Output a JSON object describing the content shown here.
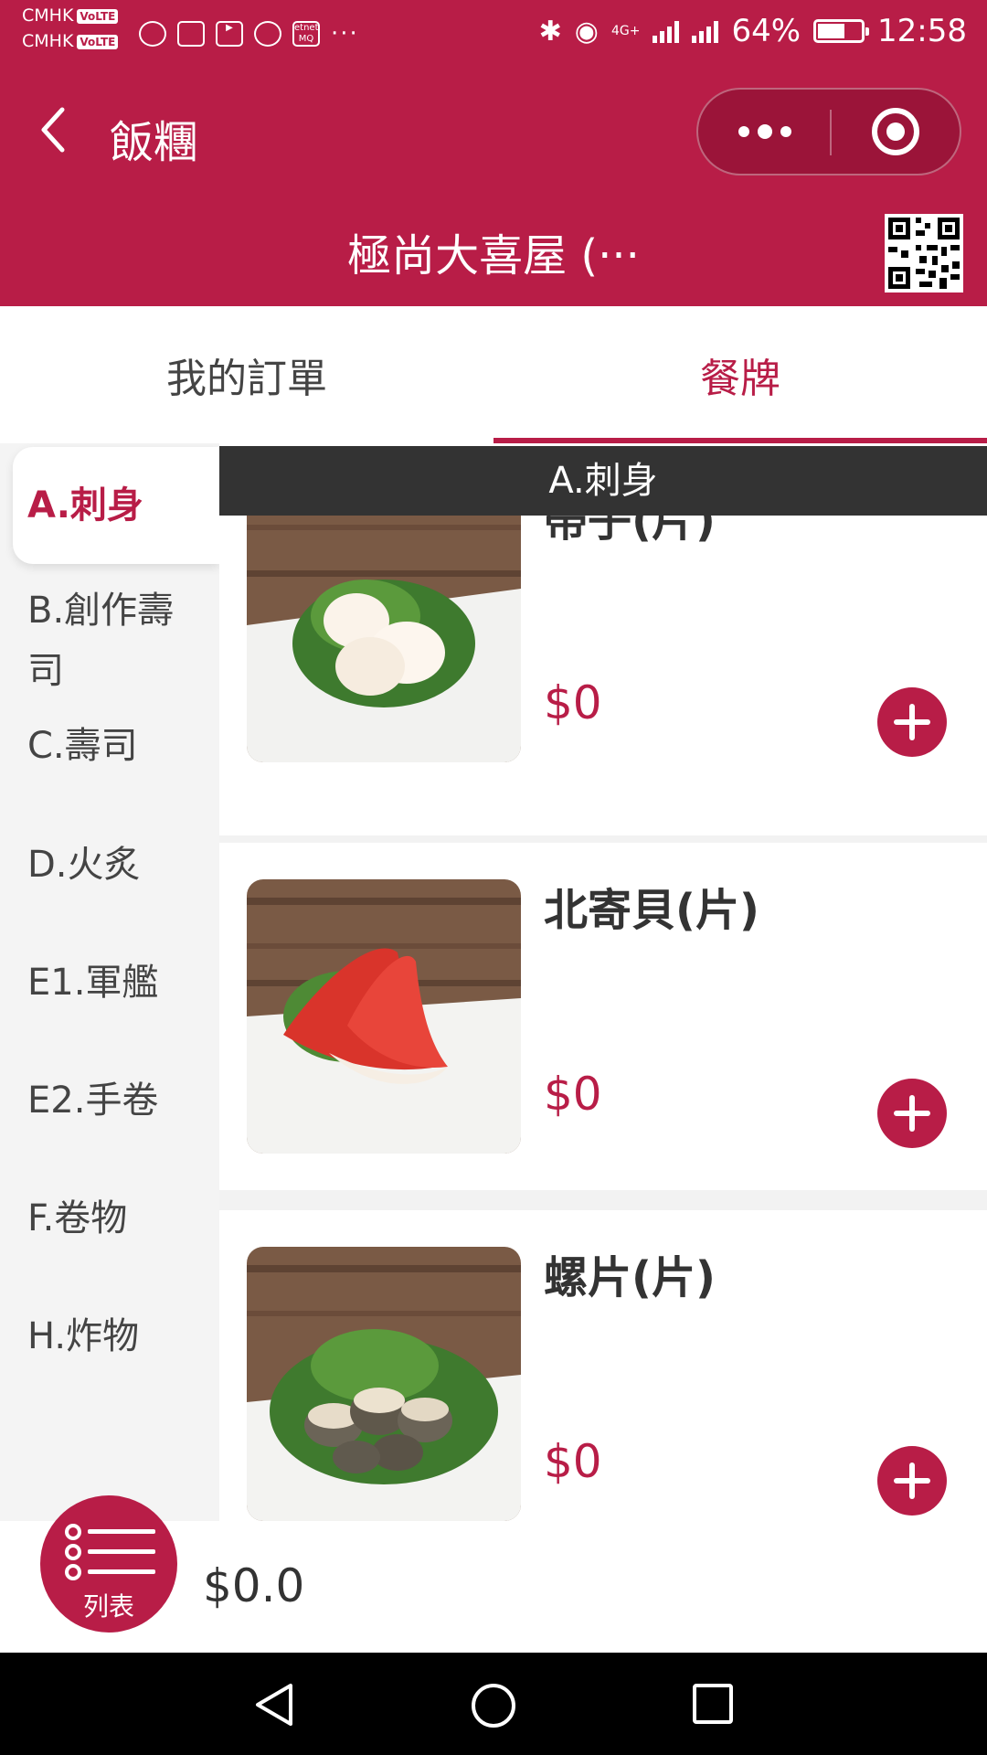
{
  "status_bar": {
    "carrier_1": "CMHK",
    "carrier_2": "CMHK",
    "volte_label": "VoLTE",
    "notification_icons": [
      "wechat-icon",
      "news-icon",
      "youtube-icon",
      "c-app-icon",
      "etnet-icon"
    ],
    "etnet_label": "etnet MQ",
    "more": "···",
    "network": "4G+",
    "battery": "64%",
    "battery_level": 0.64,
    "time": "12:58"
  },
  "header": {
    "title": "飯糰",
    "shop_name": "極尚大喜屋 (···"
  },
  "tabs": [
    {
      "label": "我的訂單",
      "active": false
    },
    {
      "label": "餐牌",
      "active": true
    }
  ],
  "categories": [
    {
      "label": "A.刺身",
      "active": true
    },
    {
      "label": "B.創作壽司"
    },
    {
      "label": "C.壽司"
    },
    {
      "label": "D.火炙"
    },
    {
      "label": "E1.軍艦"
    },
    {
      "label": "E2.手卷"
    },
    {
      "label": "F.卷物"
    },
    {
      "label": "H.炸物"
    }
  ],
  "section_title": "A.刺身",
  "items": [
    {
      "name": "帶子(片)",
      "price": "$0",
      "image": "scallop-sashimi"
    },
    {
      "name": "北寄貝(片)",
      "price": "$0",
      "image": "surf-clam-sashimi"
    },
    {
      "name": "螺片(片)",
      "price": "$0",
      "image": "whelk-sashimi"
    }
  ],
  "cart": {
    "button_label": "列表",
    "total": "$0.0"
  },
  "colors": {
    "brand": "#b81d47",
    "section_bar": "#333333",
    "sidebar_bg": "#f4f4f4"
  }
}
